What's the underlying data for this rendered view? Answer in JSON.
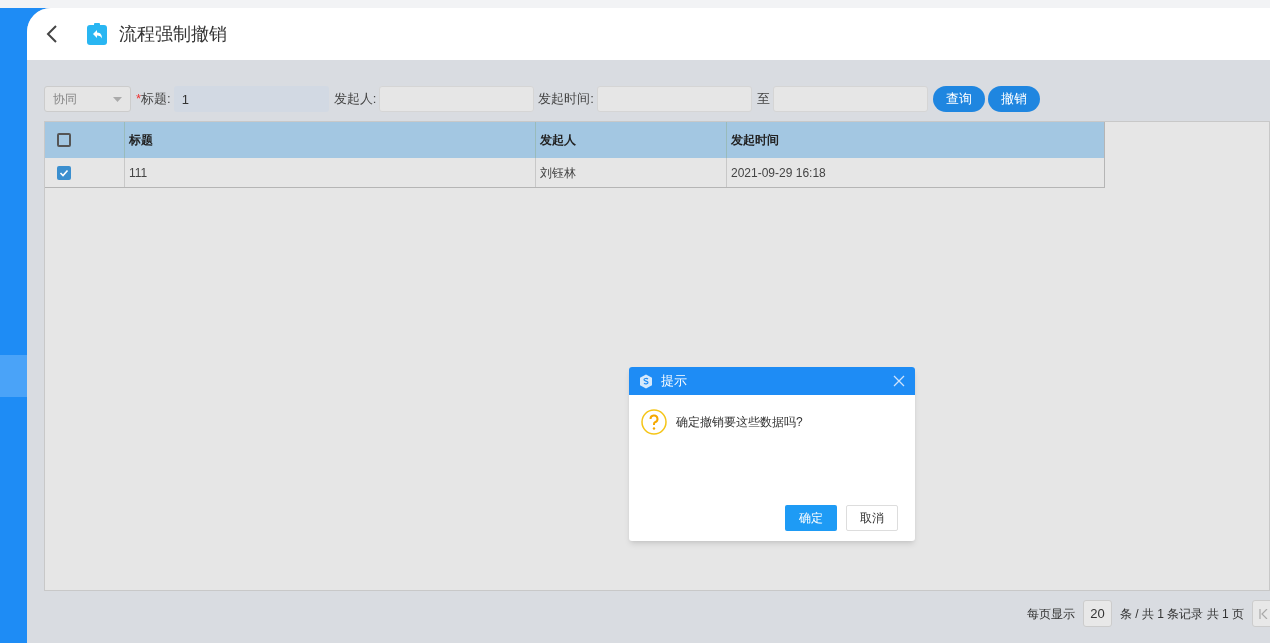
{
  "header": {
    "title": "流程强制撤销"
  },
  "filters": {
    "type_select": {
      "value": "协同"
    },
    "title_label": "标题:",
    "required_mark": "*",
    "title_value": "1",
    "initiator_label": "发起人:",
    "time_label": "发起时间:",
    "to_label": "至",
    "buttons": [
      "查询",
      "撤销"
    ]
  },
  "table": {
    "header_checked": false,
    "columns": [
      "标题",
      "发起人",
      "发起时间"
    ],
    "rows": [
      {
        "checked": true,
        "cells": [
          "111",
          "刘钰林",
          "2021-09-29 16:18"
        ]
      }
    ]
  },
  "pagination": {
    "per_page_label": "每页显示",
    "page_size": "20",
    "summary": "条 / 共 1 条记录 共 1 页"
  },
  "dialog": {
    "title": "提示",
    "message": "确定撤销要这些数据吗?",
    "buttons": [
      "确定",
      "取消"
    ]
  }
}
